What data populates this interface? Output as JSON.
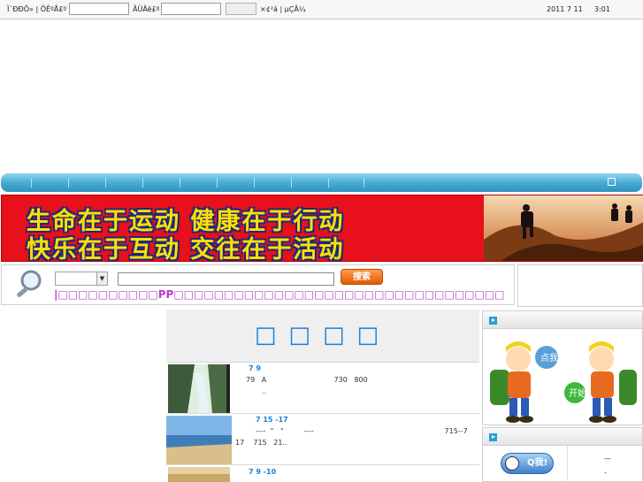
{
  "topbar": {
    "user_label": "Ï´ÐÐÕ» | ÕÊºÅ£º",
    "pass_label": "ÃÜÂë£º",
    "links": "×¢²á | µÇÂ¼",
    "date": "2011 7 11",
    "time": "3:01"
  },
  "banner": {
    "slogan_line1": "生命在于运动  健康在于行动",
    "slogan_line2": "快乐在于互动  交往在于活动"
  },
  "search": {
    "button_label": "搜索",
    "marquee": "|□□□□□□□□□□PP□□□□□□□□□□□□□□□□□□□□□□□□□□□□□□□□□"
  },
  "main": {
    "title": "□□□□",
    "items": [
      {
        "title": "7 9",
        "line1": "79   A                              730   800",
        "line2": ".."
      },
      {
        "title": "7 15 -17",
        "line1": "----  \"   \"         ----                                                          715--7",
        "line2": "17    715   21.."
      },
      {
        "title": "7 9 -10",
        "line1": "",
        "line2": ""
      }
    ]
  },
  "right": {
    "qq_label": "Q我!",
    "dash1": "—",
    "dash2": "-"
  },
  "colors": {
    "banner_red": "#e8101a",
    "slogan_yellow": "#ffe000",
    "nav_blue": "#44a8cf",
    "title_blue": "#1a7fd6"
  }
}
